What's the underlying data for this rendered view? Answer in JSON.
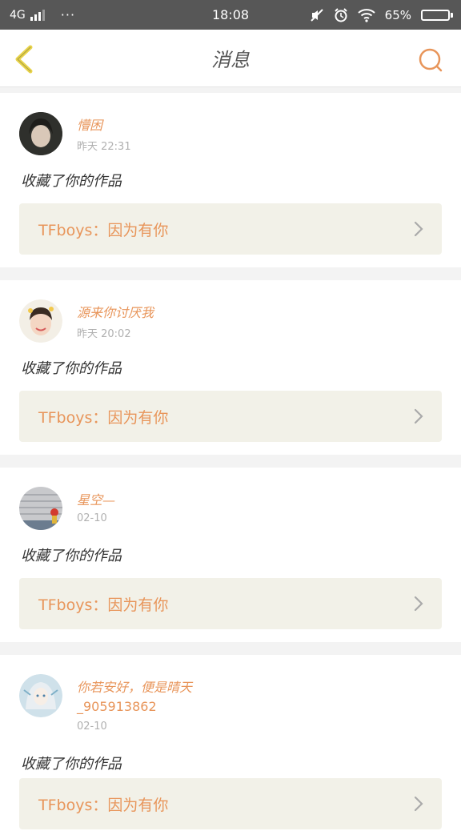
{
  "status_bar": {
    "network": "4G",
    "dots": "···",
    "time": "18:08",
    "battery": "65%",
    "battery_level": 0.65
  },
  "header": {
    "title": "消息",
    "back_icon": "chevron-left-icon",
    "search_icon": "search-icon"
  },
  "colors": {
    "accent": "#e8955a",
    "back_icon": "#e8d34a",
    "card_bg": "#f2f1e8"
  },
  "messages": [
    {
      "name": "懵困",
      "name2": "",
      "time": "昨天 22:31",
      "action": "收藏了你的作品",
      "work": "TFboys：因为有你"
    },
    {
      "name": "源来你讨厌我",
      "name2": "",
      "time": "昨天 20:02",
      "action": "收藏了你的作品",
      "work": "TFboys：因为有你"
    },
    {
      "name": "星空—",
      "name2": "",
      "time": "02-10",
      "action": "收藏了你的作品",
      "work": "TFboys：因为有你"
    },
    {
      "name": "你若安好，便是晴天",
      "name2": "_905913862",
      "time": "02-10",
      "action": "收藏了你的作品",
      "work": "TFboys：因为有你"
    }
  ]
}
